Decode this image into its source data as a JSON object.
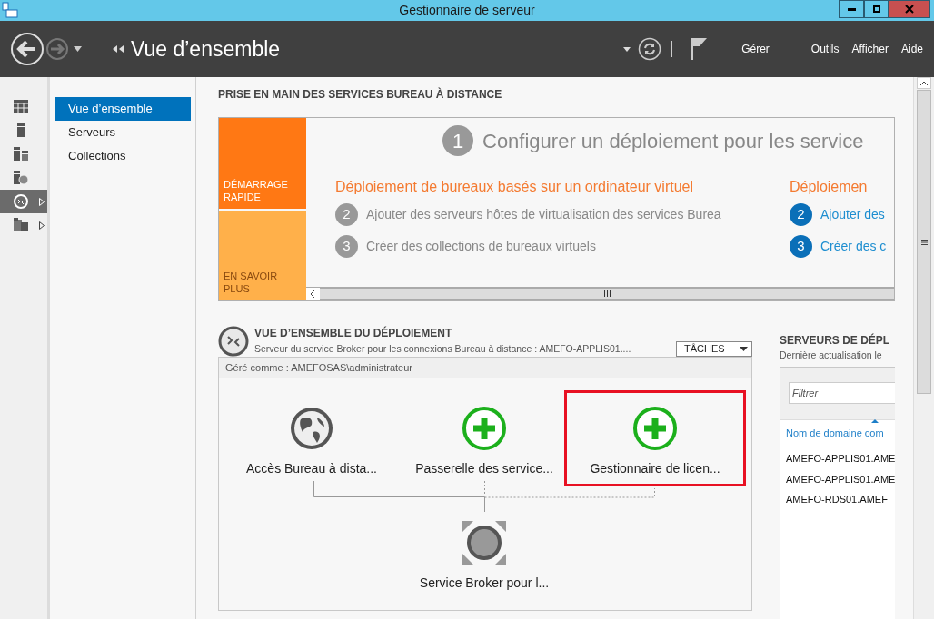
{
  "window": {
    "title": "Gestionnaire de serveur"
  },
  "header": {
    "breadcrumb": "Vue d’ensemble",
    "menu": [
      "Gérer",
      "Outils",
      "Afficher",
      "Aide"
    ]
  },
  "rail": [
    {
      "kind": "dashboard",
      "selected": false,
      "expandable": false
    },
    {
      "kind": "server",
      "selected": false,
      "expandable": false
    },
    {
      "kind": "servers",
      "selected": false,
      "expandable": false
    },
    {
      "kind": "role",
      "selected": false,
      "expandable": false
    },
    {
      "kind": "rds",
      "selected": true,
      "expandable": true
    },
    {
      "kind": "files",
      "selected": false,
      "expandable": true
    }
  ],
  "nav": [
    {
      "label": "Vue d’ensemble",
      "selected": true
    },
    {
      "label": "Serveurs",
      "selected": false
    },
    {
      "label": "Collections",
      "selected": false
    }
  ],
  "quick_start": {
    "heading": "PRISE EN MAIN DES SERVICES BUREAU À DISTANCE",
    "tiles": [
      {
        "kind": "primary",
        "label": "DÉMARRAGE RAPIDE"
      },
      {
        "kind": "secondary",
        "label": "EN SAVOIR PLUS"
      }
    ],
    "step_one": {
      "number": "1",
      "text": "Configurer un déploiement pour les service"
    },
    "columns": [
      {
        "title": "Déploiement de bureaux basés sur un ordinateur virtuel",
        "steps": [
          {
            "number": "2",
            "text": "Ajouter des serveurs hôtes de virtualisation des services Burea",
            "link": false
          },
          {
            "number": "3",
            "text": "Créer des collections de bureaux virtuels",
            "link": false
          }
        ]
      },
      {
        "title": "Déploiemen",
        "steps": [
          {
            "number": "2",
            "text": "Ajouter des",
            "link": true
          },
          {
            "number": "3",
            "text": "Créer des c",
            "link": true
          }
        ]
      }
    ]
  },
  "deployment": {
    "title": "VUE D’ENSEMBLE DU DÉPLOIEMENT",
    "subtitle": "Serveur du service Broker pour les connexions Bureau à distance : AMEFO-APPLIS01....",
    "tasks": "TÂCHES",
    "managed_as": "Géré comme : AMEFOSAS\\administrateur",
    "nodes": [
      {
        "kind": "globe",
        "label": "Accès Bureau à dista...",
        "highlighted": false
      },
      {
        "kind": "add",
        "label": "Passerelle des service...",
        "highlighted": false
      },
      {
        "kind": "add",
        "label": "Gestionnaire de licen...",
        "highlighted": true
      },
      {
        "kind": "broker",
        "label": "Service Broker pour l...",
        "highlighted": false
      }
    ]
  },
  "servers": {
    "title": "SERVEURS DE DÉPL",
    "subtitle": "Dernière actualisation le",
    "filter_placeholder": "Filtrer",
    "column": "Nom de domaine com",
    "rows": [
      "AMEFO-APPLIS01.AME",
      "AMEFO-APPLIS01.AME",
      "AMEFO-RDS01.AMEF"
    ]
  }
}
